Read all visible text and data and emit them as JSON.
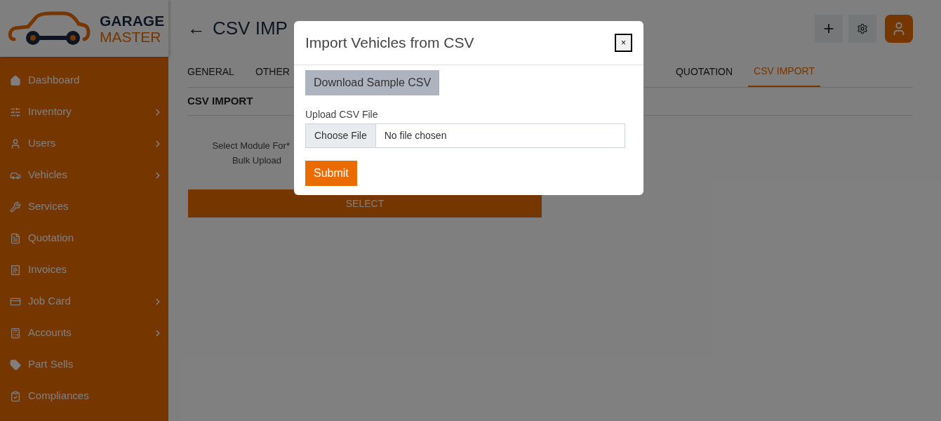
{
  "brand": {
    "line1": "GARAGE",
    "line2": "MASTER"
  },
  "sidebar": {
    "items": [
      {
        "label": "Dashboard",
        "expandable": false
      },
      {
        "label": "Inventory",
        "expandable": true
      },
      {
        "label": "Users",
        "expandable": true
      },
      {
        "label": "Vehicles",
        "expandable": true
      },
      {
        "label": "Services",
        "expandable": false
      },
      {
        "label": "Quotation",
        "expandable": false
      },
      {
        "label": "Invoices",
        "expandable": false
      },
      {
        "label": "Job Card",
        "expandable": true
      },
      {
        "label": "Accounts",
        "expandable": true
      },
      {
        "label": "Part Sells",
        "expandable": false
      },
      {
        "label": "Compliances",
        "expandable": false
      }
    ]
  },
  "header": {
    "back": "←",
    "title": "CSV IMP",
    "add": "+"
  },
  "tabs": [
    {
      "label": "GENERAL",
      "selected": false
    },
    {
      "label": "OTHER",
      "selected": false
    },
    {
      "label": "QUOTATION",
      "selected": false
    },
    {
      "label": "CSV IMPORT",
      "selected": true
    }
  ],
  "section": {
    "title": "CSV IMPORT",
    "field_label_1": "Select Module For*",
    "field_label_2": "Bulk Upload",
    "select_button": "SELECT"
  },
  "modal": {
    "title": "Import Vehicles from CSV",
    "close": "×",
    "download_button": "Download Sample CSV",
    "upload_label": "Upload CSV File",
    "choose_button": "Choose File",
    "file_status": "No file chosen",
    "submit": "Submit"
  }
}
